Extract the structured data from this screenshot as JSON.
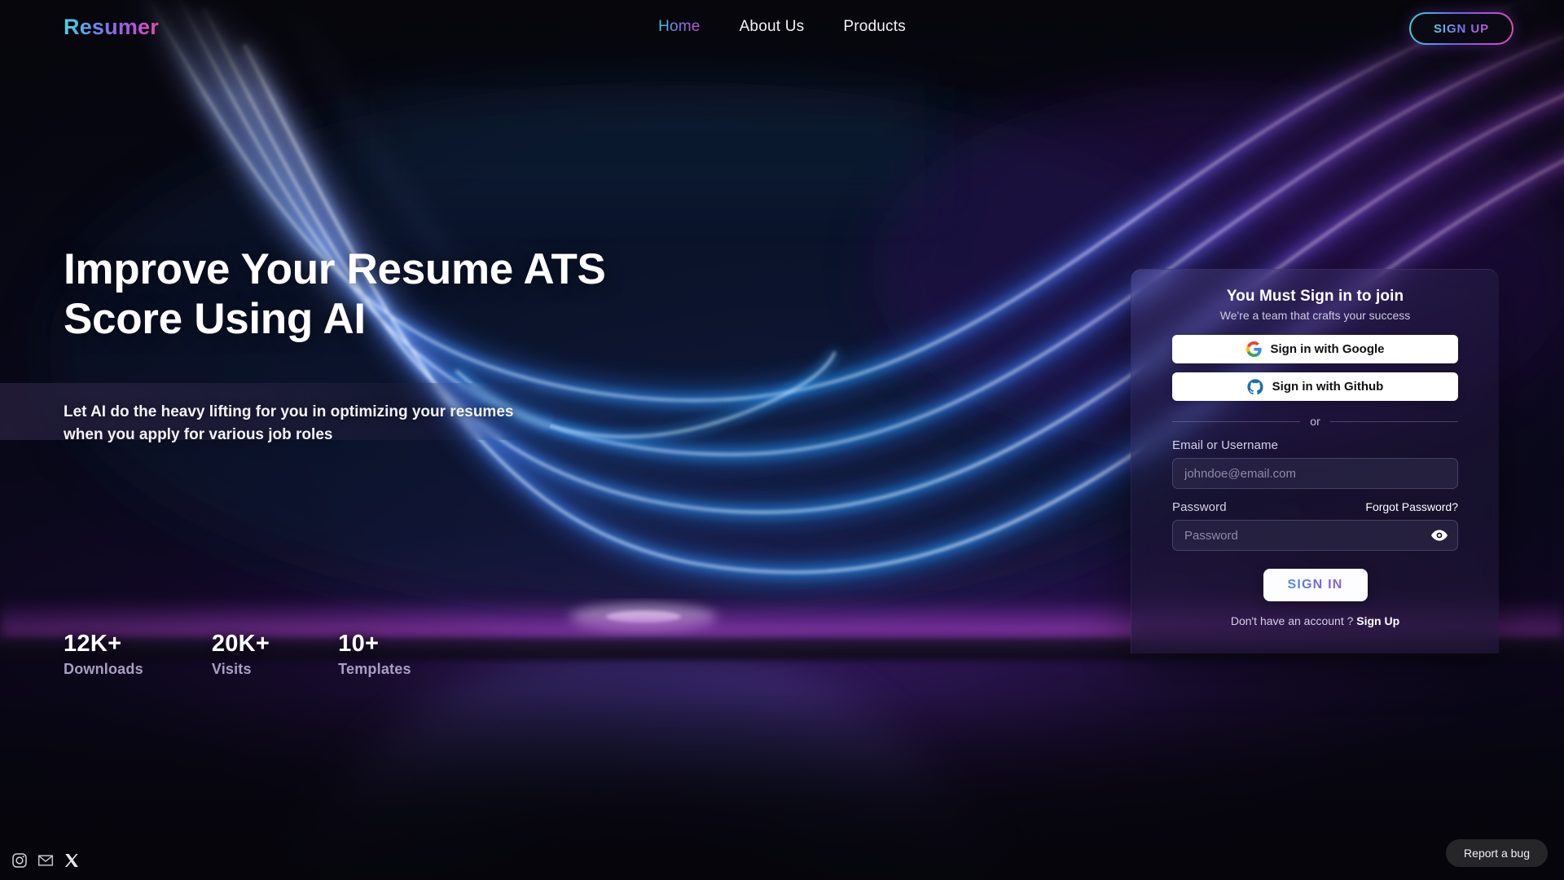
{
  "brand": {
    "name": "Resumer"
  },
  "nav": {
    "links": [
      {
        "label": "Home",
        "active": true
      },
      {
        "label": "About Us",
        "active": false
      },
      {
        "label": "Products",
        "active": false
      }
    ],
    "signup_label": "SIGN UP"
  },
  "hero": {
    "title_line1": "Improve Your Resume ATS",
    "title_line2": "Score Using AI",
    "subtitle_line1": "Let AI do the heavy lifting for you in optimizing your resumes",
    "subtitle_line2": "when you apply for various job roles"
  },
  "stats": [
    {
      "value": "12K+",
      "label": "Downloads"
    },
    {
      "value": "20K+",
      "label": "Visits"
    },
    {
      "value": "10+",
      "label": "Templates"
    }
  ],
  "auth": {
    "title": "You Must Sign in to join",
    "subtitle": "We're a team that crafts your success",
    "google_label": "Sign in with Google",
    "github_label": "Sign in with Github",
    "divider_text": "or",
    "email_label": "Email or Username",
    "email_placeholder": "johndoe@email.com",
    "email_value": "",
    "password_label": "Password",
    "forgot_label": "Forgot Password?",
    "password_placeholder": "Password",
    "password_value": "",
    "submit_label": "SIGN IN",
    "footer_prefix": "Don't have an account ?",
    "footer_link": "Sign Up"
  },
  "footer": {
    "socials": [
      "instagram-icon",
      "email-icon",
      "x-twitter-icon"
    ],
    "report_label": "Report a bug"
  },
  "colors": {
    "accent_cyan": "#3fd4dd",
    "accent_purple": "#8f5ee0",
    "accent_pink": "#e0529e",
    "neon_blue": "#1e7bff",
    "neon_violet": "#9a3df0",
    "card_bg": "#2a2350",
    "page_bg": "#07070d"
  }
}
